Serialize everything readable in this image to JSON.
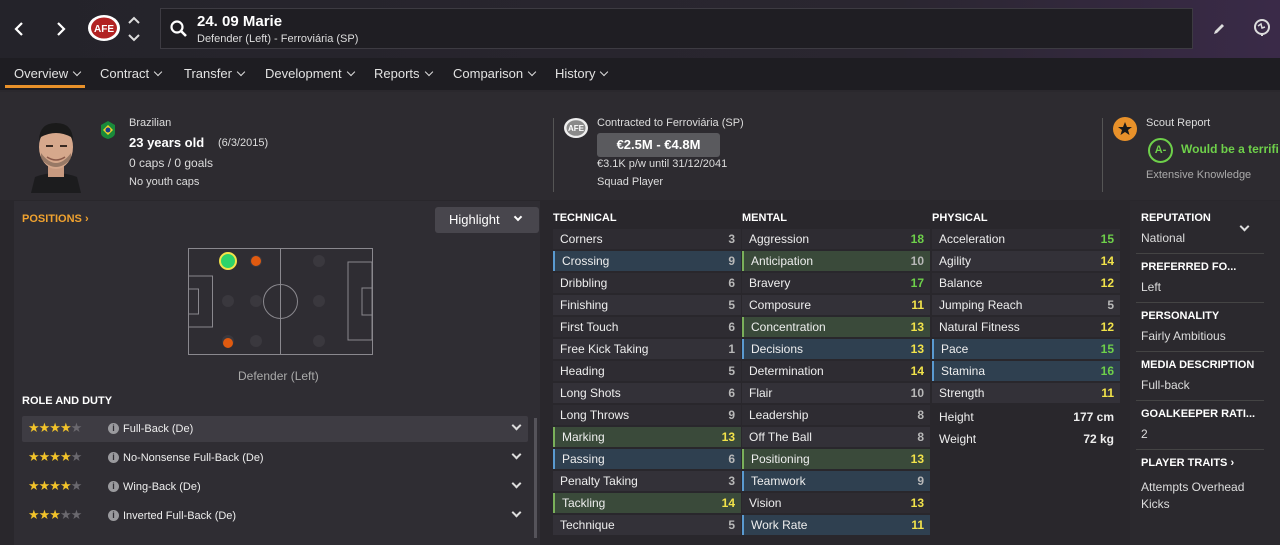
{
  "header": {
    "player_name": "24. 09 Marie",
    "player_sub": "Defender (Left) - Ferroviária (SP)"
  },
  "tabs": [
    {
      "label": "Overview"
    },
    {
      "label": "Contract"
    },
    {
      "label": "Transfer"
    },
    {
      "label": "Development"
    },
    {
      "label": "Reports"
    },
    {
      "label": "Comparison"
    },
    {
      "label": "History"
    }
  ],
  "profile": {
    "nationality": "Brazilian",
    "age": "23 years old",
    "dob": "(6/3/2015)",
    "caps": "0 caps / 0 goals",
    "youth": "No youth caps"
  },
  "contract": {
    "club": "Contracted to Ferroviária (SP)",
    "value": "€2.5M - €4.8M",
    "wage": "€3.1K p/w until 31/12/2041",
    "status": "Squad Player"
  },
  "scout": {
    "title": "Scout Report",
    "grade": "A-",
    "verdict": "Would be a terrifi",
    "knowledge": "Extensive Knowledge"
  },
  "positions": {
    "title": "POSITIONS",
    "highlight": "Highlight",
    "label": "Defender (Left)"
  },
  "roles": {
    "title": "ROLE AND DUTY",
    "items": [
      {
        "name": "Full-Back (De)",
        "stars": 4
      },
      {
        "name": "No-Nonsense Full-Back (De)",
        "stars": 4
      },
      {
        "name": "Wing-Back (De)",
        "stars": 4
      },
      {
        "name": "Inverted Full-Back (De)",
        "stars": 3
      }
    ]
  },
  "attributes": {
    "technical_title": "TECHNICAL",
    "mental_title": "MENTAL",
    "physical_title": "PHYSICAL",
    "technical": [
      {
        "name": "Corners",
        "value": "3",
        "hl": ""
      },
      {
        "name": "Crossing",
        "value": "9",
        "hl": "B"
      },
      {
        "name": "Dribbling",
        "value": "6",
        "hl": ""
      },
      {
        "name": "Finishing",
        "value": "5",
        "hl": ""
      },
      {
        "name": "First Touch",
        "value": "6",
        "hl": ""
      },
      {
        "name": "Free Kick Taking",
        "value": "1",
        "hl": ""
      },
      {
        "name": "Heading",
        "value": "5",
        "hl": ""
      },
      {
        "name": "Long Shots",
        "value": "6",
        "hl": ""
      },
      {
        "name": "Long Throws",
        "value": "9",
        "hl": ""
      },
      {
        "name": "Marking",
        "value": "13",
        "hl": "G"
      },
      {
        "name": "Passing",
        "value": "6",
        "hl": "B"
      },
      {
        "name": "Penalty Taking",
        "value": "3",
        "hl": ""
      },
      {
        "name": "Tackling",
        "value": "14",
        "hl": "G"
      },
      {
        "name": "Technique",
        "value": "5",
        "hl": ""
      }
    ],
    "mental": [
      {
        "name": "Aggression",
        "value": "18",
        "hl": ""
      },
      {
        "name": "Anticipation",
        "value": "10",
        "hl": "G"
      },
      {
        "name": "Bravery",
        "value": "17",
        "hl": ""
      },
      {
        "name": "Composure",
        "value": "11",
        "hl": ""
      },
      {
        "name": "Concentration",
        "value": "13",
        "hl": "G"
      },
      {
        "name": "Decisions",
        "value": "13",
        "hl": "B"
      },
      {
        "name": "Determination",
        "value": "14",
        "hl": ""
      },
      {
        "name": "Flair",
        "value": "10",
        "hl": ""
      },
      {
        "name": "Leadership",
        "value": "8",
        "hl": ""
      },
      {
        "name": "Off The Ball",
        "value": "8",
        "hl": ""
      },
      {
        "name": "Positioning",
        "value": "13",
        "hl": "G"
      },
      {
        "name": "Teamwork",
        "value": "9",
        "hl": "B"
      },
      {
        "name": "Vision",
        "value": "13",
        "hl": ""
      },
      {
        "name": "Work Rate",
        "value": "11",
        "hl": "B"
      }
    ],
    "physical": [
      {
        "name": "Acceleration",
        "value": "15",
        "hl": ""
      },
      {
        "name": "Agility",
        "value": "14",
        "hl": ""
      },
      {
        "name": "Balance",
        "value": "12",
        "hl": ""
      },
      {
        "name": "Jumping Reach",
        "value": "5",
        "hl": ""
      },
      {
        "name": "Natural Fitness",
        "value": "12",
        "hl": ""
      },
      {
        "name": "Pace",
        "value": "15",
        "hl": "B"
      },
      {
        "name": "Stamina",
        "value": "16",
        "hl": "B"
      },
      {
        "name": "Strength",
        "value": "11",
        "hl": ""
      }
    ],
    "height_label": "Height",
    "height": "177 cm",
    "weight_label": "Weight",
    "weight": "72 kg"
  },
  "sidebar": {
    "reputation_h": "REPUTATION",
    "reputation": "National",
    "foot_h": "PREFERRED FO...",
    "foot": "Left",
    "personality_h": "PERSONALITY",
    "personality": "Fairly Ambitious",
    "media_h": "MEDIA DESCRIPTION",
    "media": "Full-back",
    "gk_h": "GOALKEEPER RATI...",
    "gk": "2",
    "traits_h": "PLAYER TRAITS",
    "traits": "Attempts Overhead Kicks"
  },
  "colors": {
    "accent": "#e8912a",
    "high": "#6ed04a",
    "mid": "#f2e34a",
    "low": "#b8b8b8"
  }
}
